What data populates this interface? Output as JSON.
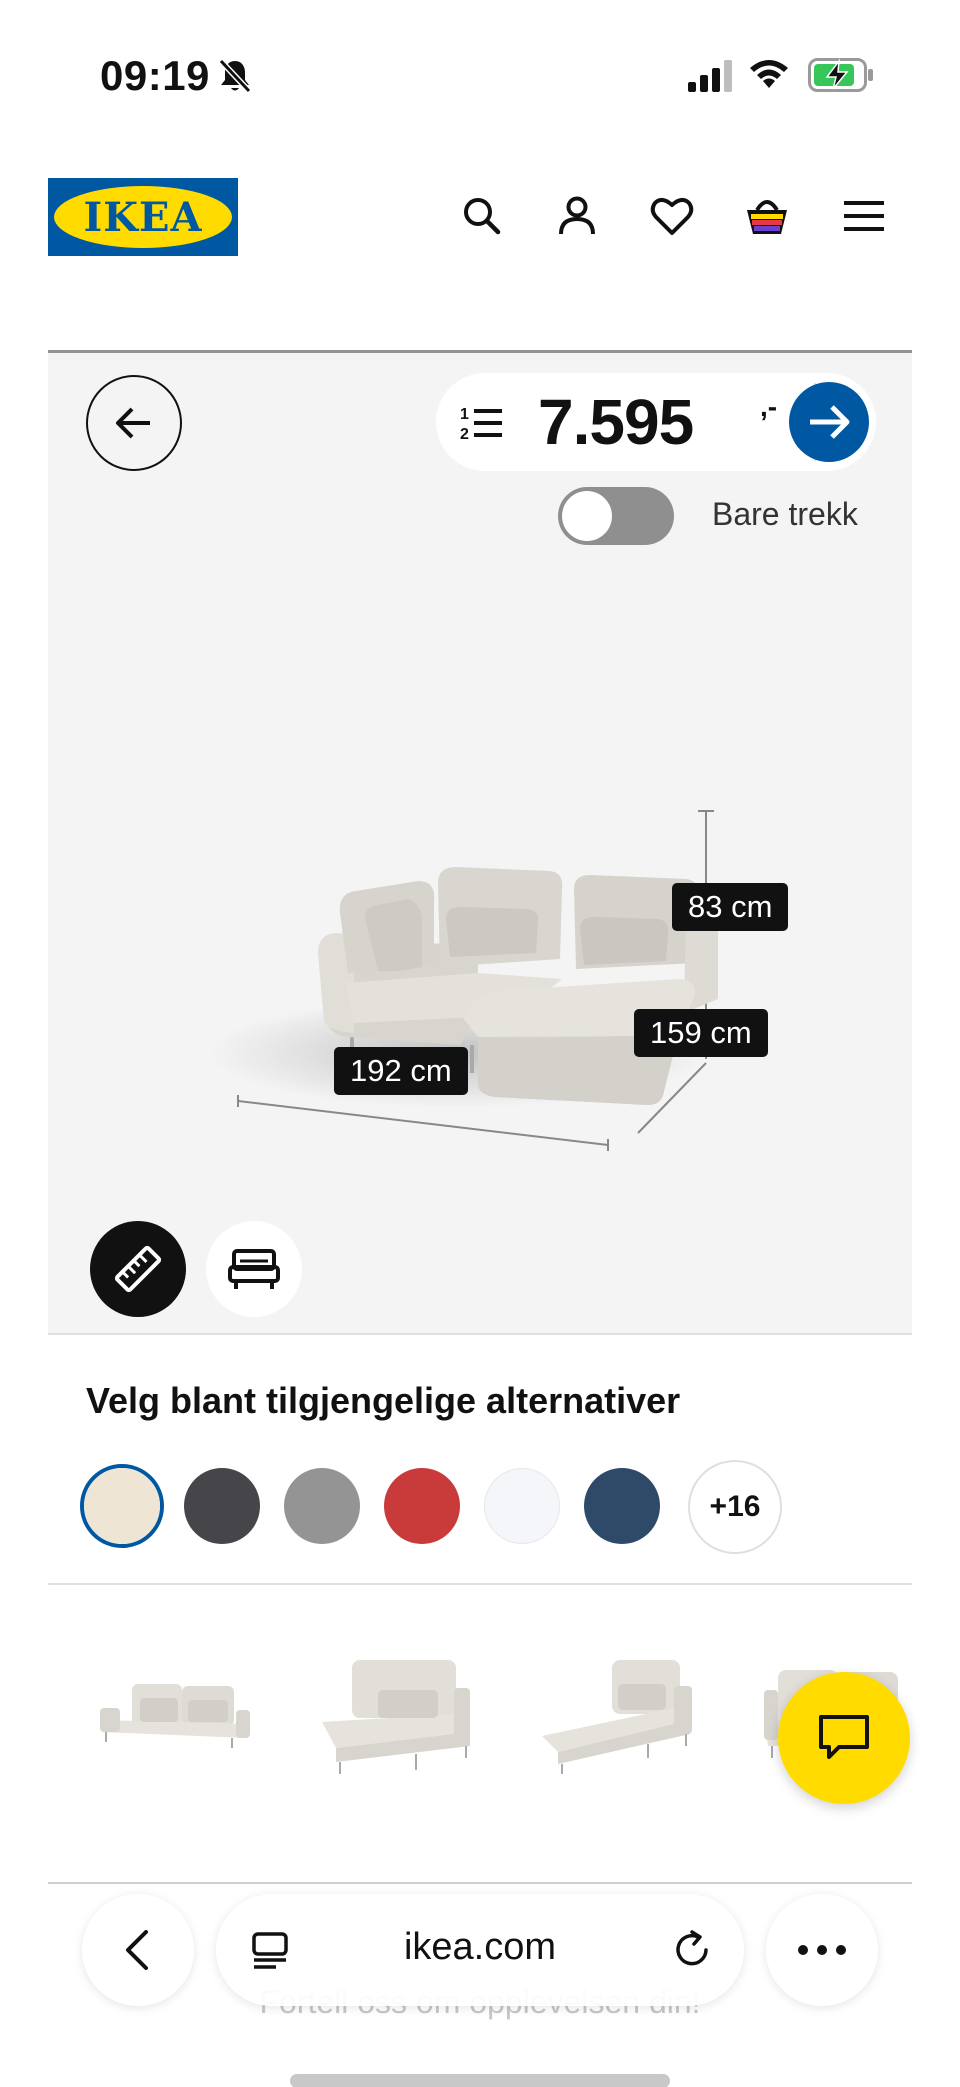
{
  "status_bar": {
    "time": "09:19"
  },
  "header": {
    "logo_text": "IKEA"
  },
  "configurator": {
    "price": "7.595",
    "price_suffix": ",-",
    "toggle_label": "Bare trekk",
    "toggle_on": false,
    "dimensions": {
      "height": "83 cm",
      "depth": "159 cm",
      "width": "192 cm"
    }
  },
  "options": {
    "title": "Velg blant tilgjengelige alternativer",
    "swatches": [
      {
        "color": "#efe5d5",
        "selected": true
      },
      {
        "color": "#45454a"
      },
      {
        "color": "#949494"
      },
      {
        "color": "#c93b3b"
      },
      {
        "color": "#f4f6f9"
      },
      {
        "color": "#2e4a68"
      }
    ],
    "more_label": "+16"
  },
  "footer": {
    "feedback_text": "Fortell oss om opplevelsen din!"
  },
  "browser": {
    "url": "ikea.com"
  },
  "colors": {
    "brand_blue": "#0058a3",
    "brand_yellow": "#ffdb00"
  }
}
